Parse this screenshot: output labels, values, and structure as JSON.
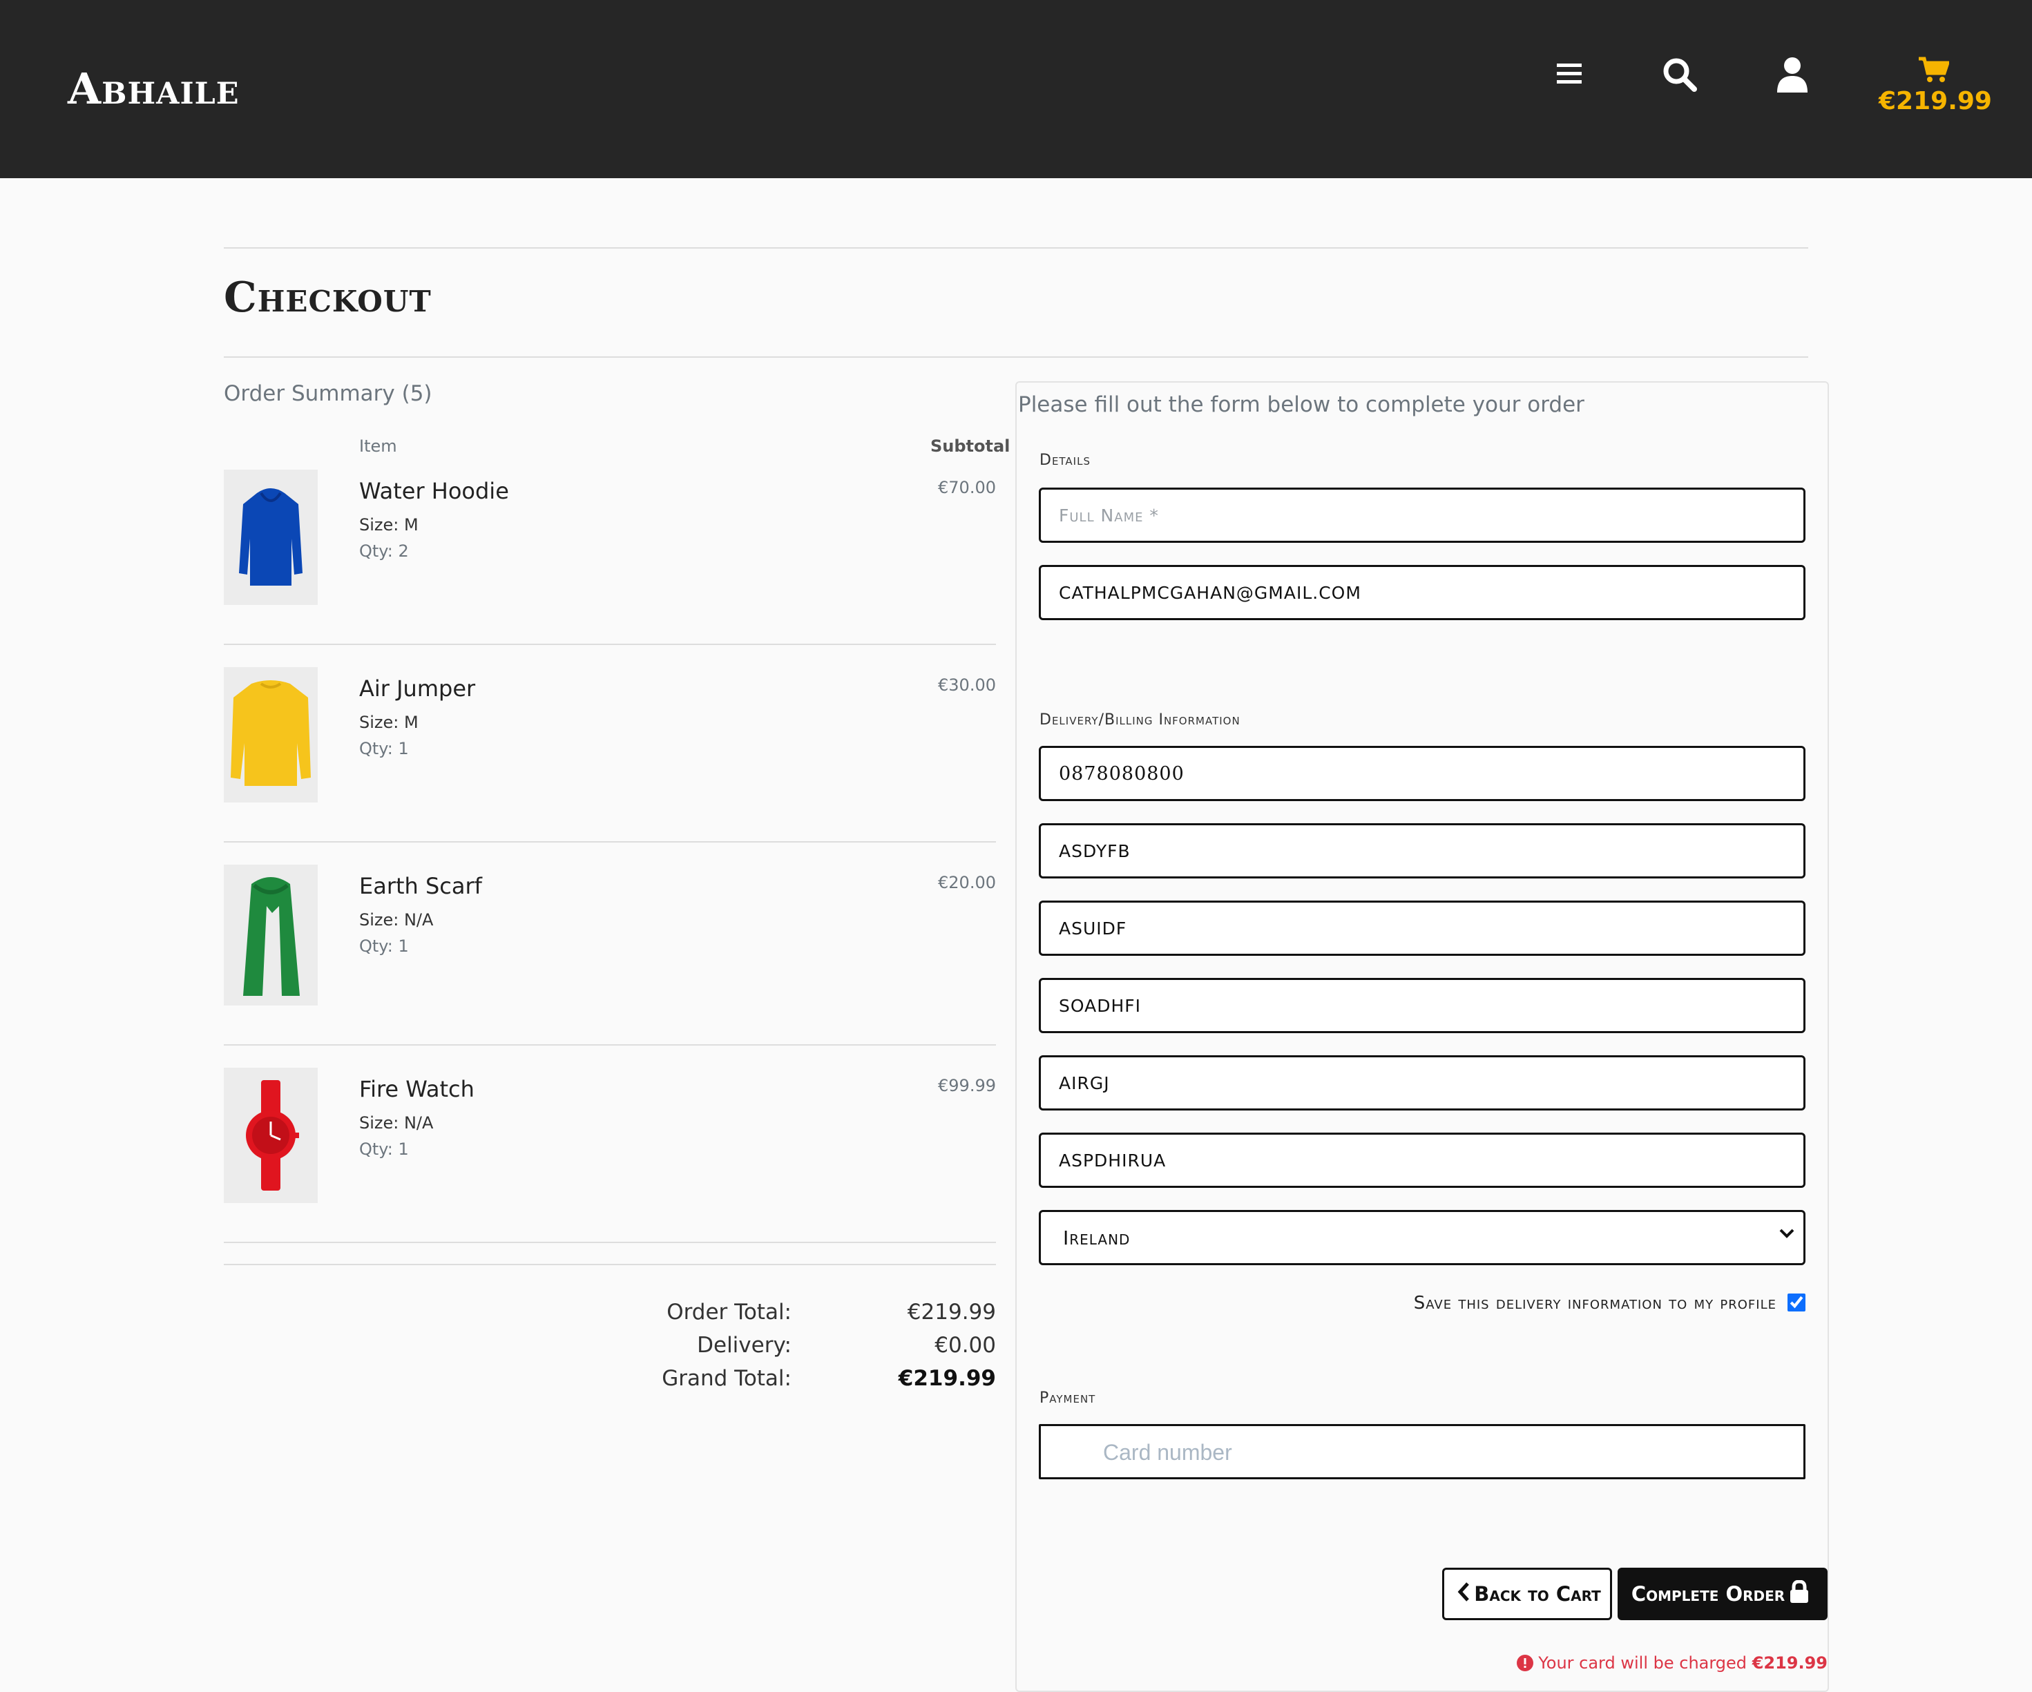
{
  "header": {
    "brand": "Abhaile",
    "cart_total": "€219.99",
    "icons": [
      "menu-icon",
      "search-icon",
      "user-icon",
      "cart-icon"
    ],
    "accent_color": "#f6b400"
  },
  "page": {
    "title": "Checkout"
  },
  "summary": {
    "label": "Order Summary (5)",
    "col_item": "Item",
    "col_subtotal": "Subtotal",
    "items": [
      {
        "name": "Water Hoodie",
        "size": "Size: M",
        "qty": "Qty: 2",
        "price": "€70.00",
        "color": "#0b47b5"
      },
      {
        "name": "Air Jumper",
        "size": "Size: M",
        "qty": "Qty: 1",
        "price": "€30.00",
        "color": "#f6c41c"
      },
      {
        "name": "Earth Scarf",
        "size": "Size: N/A",
        "qty": "Qty: 1",
        "price": "€20.00",
        "color": "#1f8a3e"
      },
      {
        "name": "Fire Watch",
        "size": "Size: N/A",
        "qty": "Qty: 1",
        "price": "€99.99",
        "color": "#e0151f"
      }
    ],
    "totals": {
      "order_total_label": "Order Total:",
      "order_total": "€219.99",
      "delivery_label": "Delivery:",
      "delivery": "€0.00",
      "grand_total_label": "Grand Total:",
      "grand_total": "€219.99"
    }
  },
  "form": {
    "intro": "Please fill out the form below to complete your order",
    "details_legend": "Details",
    "full_name_placeholder": "Full Name *",
    "full_name_value": "",
    "email_value": "CATHALPMCGAHAN@GMAIL.COM",
    "delivery_legend": "Delivery/Billing Information",
    "phone_value": "0878080800",
    "address_fields": [
      "ASDYFB",
      "ASUIDF",
      "SOADHFI",
      "AIRGJ",
      "ASPDHIRUA"
    ],
    "country_selected": "Ireland",
    "save_info_label": "Save this delivery information to my profile",
    "save_info_checked": true,
    "payment_legend": "Payment",
    "card_placeholder": "Card number",
    "back_button": "Back to Cart",
    "complete_button": "Complete Order",
    "charge_note": "Your card will be charged",
    "charge_amount": "€219.99",
    "error_color": "#dc3545"
  }
}
